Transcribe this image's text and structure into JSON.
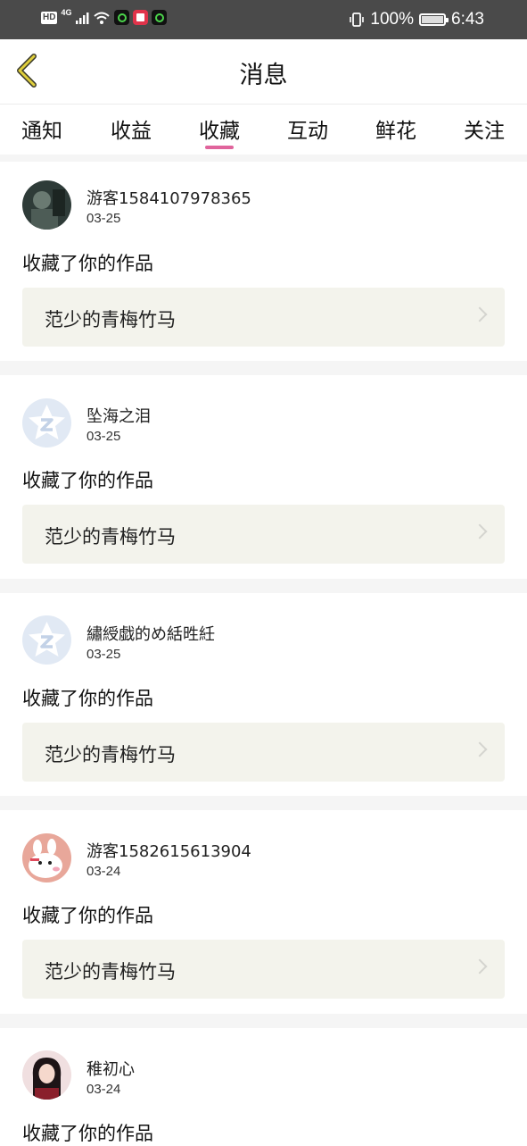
{
  "status_bar": {
    "hd": "HD",
    "network": "4G",
    "battery_percent": "100%",
    "time": "6:43"
  },
  "header": {
    "back_icon": "chevron-left-icon",
    "title": "消息"
  },
  "tabs": {
    "items": [
      "通知",
      "收益",
      "收藏",
      "互动",
      "鲜花",
      "关注"
    ],
    "active_index": 2,
    "indicator_color": "#e0649c"
  },
  "messages": [
    {
      "username": "游客1584107978365",
      "date": "03-25",
      "action": "收藏了你的作品",
      "work_title": "范少的青梅竹马",
      "avatar": "dark-photo-avatar"
    },
    {
      "username": "坠海之泪",
      "date": "03-25",
      "action": "收藏了你的作品",
      "work_title": "范少的青梅竹马",
      "avatar": "default-z-avatar"
    },
    {
      "username": "繡綬戯的め絬甠紝",
      "date": "03-25",
      "action": "收藏了你的作品",
      "work_title": "范少的青梅竹马",
      "avatar": "default-z-avatar"
    },
    {
      "username": "游客1582615613904",
      "date": "03-24",
      "action": "收藏了你的作品",
      "work_title": "范少的青梅竹马",
      "avatar": "cartoon-avatar"
    },
    {
      "username": "稚初心",
      "date": "03-24",
      "action": "收藏了你的作品",
      "avatar": "girl-photo-avatar"
    }
  ],
  "colors": {
    "status_bar_bg": "#4a4a4a",
    "work_box_bg": "#f3f3ec",
    "back_icon": "#c9b430"
  }
}
